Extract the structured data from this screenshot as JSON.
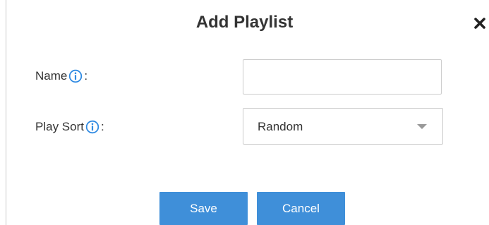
{
  "dialog": {
    "title": "Add Playlist",
    "close_icon": "close-icon"
  },
  "fields": {
    "name": {
      "label": "Name",
      "suffix": ":",
      "info_icon": "info-icon",
      "value": "",
      "placeholder": ""
    },
    "play_sort": {
      "label": "Play Sort",
      "suffix": ":",
      "info_icon": "info-icon",
      "selected": "Random",
      "caret_icon": "chevron-down-icon"
    }
  },
  "buttons": {
    "save_label": "Save",
    "cancel_label": "Cancel"
  },
  "colors": {
    "primary_button": "#3f8fd9",
    "info_icon": "#2f8ae2",
    "title_text": "#333333"
  }
}
